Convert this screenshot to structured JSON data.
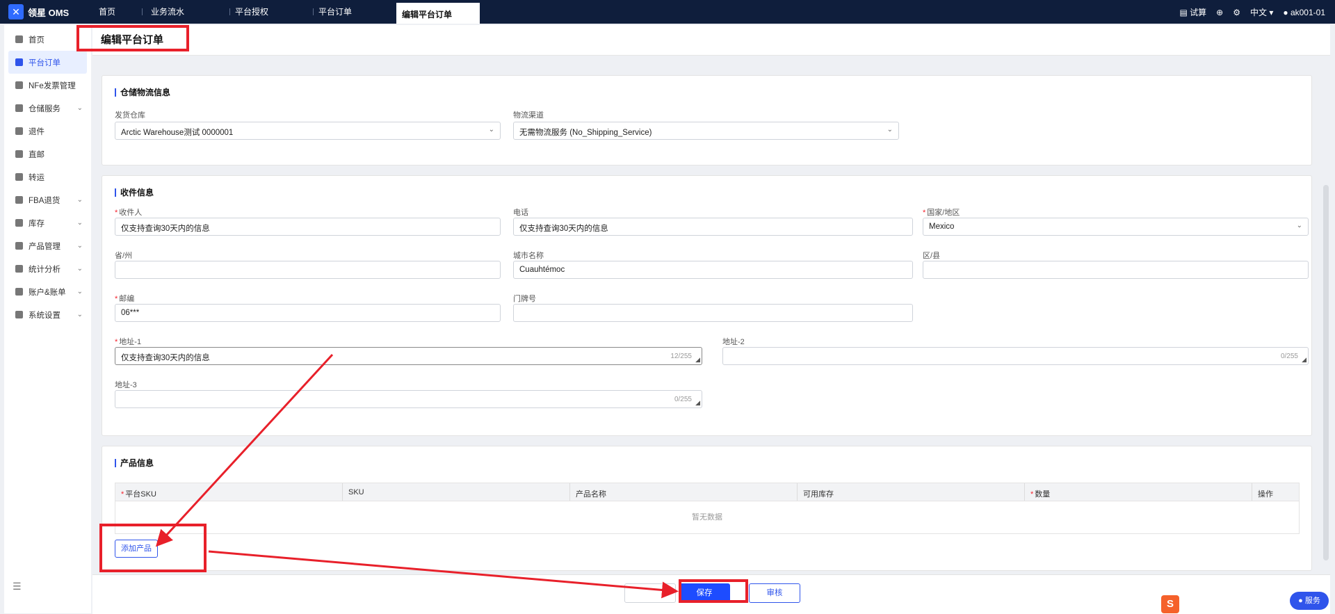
{
  "app": {
    "name": "领星 OMS"
  },
  "topnav": {
    "tabs": [
      "首页",
      "业务流水",
      "平台授权",
      "平台订单"
    ],
    "active_tab": "编辑平台订单",
    "right": {
      "calc": "试算",
      "lang": "中文",
      "user": "ak001-01"
    }
  },
  "sidebar": {
    "items": [
      {
        "label": "首页",
        "icon": "home-icon"
      },
      {
        "label": "平台订单",
        "icon": "order-icon",
        "active": true
      },
      {
        "label": "NFe发票管理",
        "icon": "invoice-icon"
      },
      {
        "label": "仓储服务",
        "icon": "warehouse-icon",
        "expandable": true
      },
      {
        "label": "退件",
        "icon": "return-icon"
      },
      {
        "label": "直邮",
        "icon": "mail-icon"
      },
      {
        "label": "转运",
        "icon": "transfer-icon"
      },
      {
        "label": "FBA退货",
        "icon": "fba-icon",
        "expandable": true
      },
      {
        "label": "库存",
        "icon": "stock-icon",
        "expandable": true
      },
      {
        "label": "产品管理",
        "icon": "product-icon",
        "expandable": true
      },
      {
        "label": "统计分析",
        "icon": "chart-icon",
        "expandable": true
      },
      {
        "label": "账户&账单",
        "icon": "account-icon",
        "expandable": true
      },
      {
        "label": "系统设置",
        "icon": "settings-icon",
        "expandable": true
      }
    ]
  },
  "page": {
    "title": "编辑平台订单"
  },
  "warehouse": {
    "title": "仓储物流信息",
    "warehouse_label": "发货仓库",
    "warehouse_value": "Arctic Warehouse测试 0000001",
    "channel_label": "物流渠道",
    "channel_value": "无需物流服务 (No_Shipping_Service)"
  },
  "receiver": {
    "title": "收件信息",
    "name_label": "收件人",
    "name_value": "仅支持查询30天内的信息",
    "phone_label": "电话",
    "phone_value": "仅支持查询30天内的信息",
    "country_label": "国家/地区",
    "country_value": "Mexico",
    "state_label": "省/州",
    "state_value": "",
    "city_label": "城市名称",
    "city_value": "Cuauhtémoc",
    "district_label": "区/县",
    "district_value": "",
    "zip_label": "邮编",
    "zip_value": "06***",
    "house_label": "门牌号",
    "house_value": "",
    "addr1_label": "地址-1",
    "addr1_value": "仅支持查询30天内的信息",
    "addr1_count": "12/255",
    "addr2_label": "地址-2",
    "addr2_value": "",
    "addr2_count": "0/255",
    "addr3_label": "地址-3",
    "addr3_value": "",
    "addr3_count": "0/255"
  },
  "product": {
    "title": "产品信息",
    "columns": [
      "平台SKU",
      "SKU",
      "产品名称",
      "可用库存",
      "数量",
      "操作"
    ],
    "empty": "暂无数据",
    "add_button": "添加产品"
  },
  "footer": {
    "save": "保存",
    "audit": "审核"
  },
  "widgets": {
    "service": "服务",
    "sogou": "S"
  }
}
